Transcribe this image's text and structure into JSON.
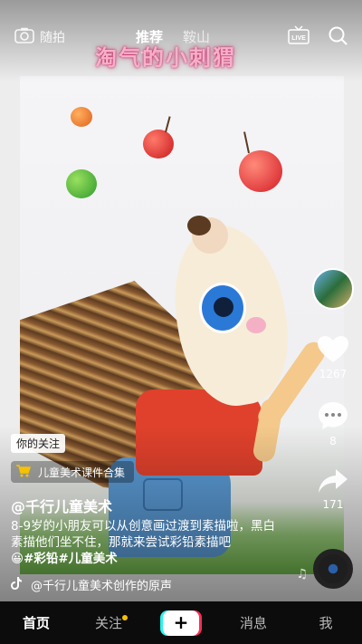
{
  "topbar": {
    "camera_label": "随拍",
    "tabs": [
      {
        "label": "推荐",
        "active": true
      },
      {
        "label": "鞍山",
        "active": false
      }
    ],
    "live_label": "LIVE"
  },
  "video": {
    "overlay_title": "淘气的小刺猬"
  },
  "rail": {
    "like_count": "1267",
    "comment_count": "8",
    "share_count": "171"
  },
  "info": {
    "follow_tag": "你的关注",
    "collection_label": "儿童美术课件合集",
    "author": "@千行儿童美术",
    "description": "8-9岁的小朋友可以从创意画过渡到素描啦，黑白素描他们坐不住，那就来尝试彩铅素描吧",
    "hashtags": "😀#彩铅#儿童美术",
    "music": "@千行儿童美术创作的原声"
  },
  "nav": {
    "home": "首页",
    "following": "关注",
    "plus": "+",
    "messages": "消息",
    "me": "我"
  },
  "colors": {
    "accent_cyan": "#25f4ee",
    "accent_red": "#fe2c55",
    "notification_dot": "#f6c200"
  }
}
